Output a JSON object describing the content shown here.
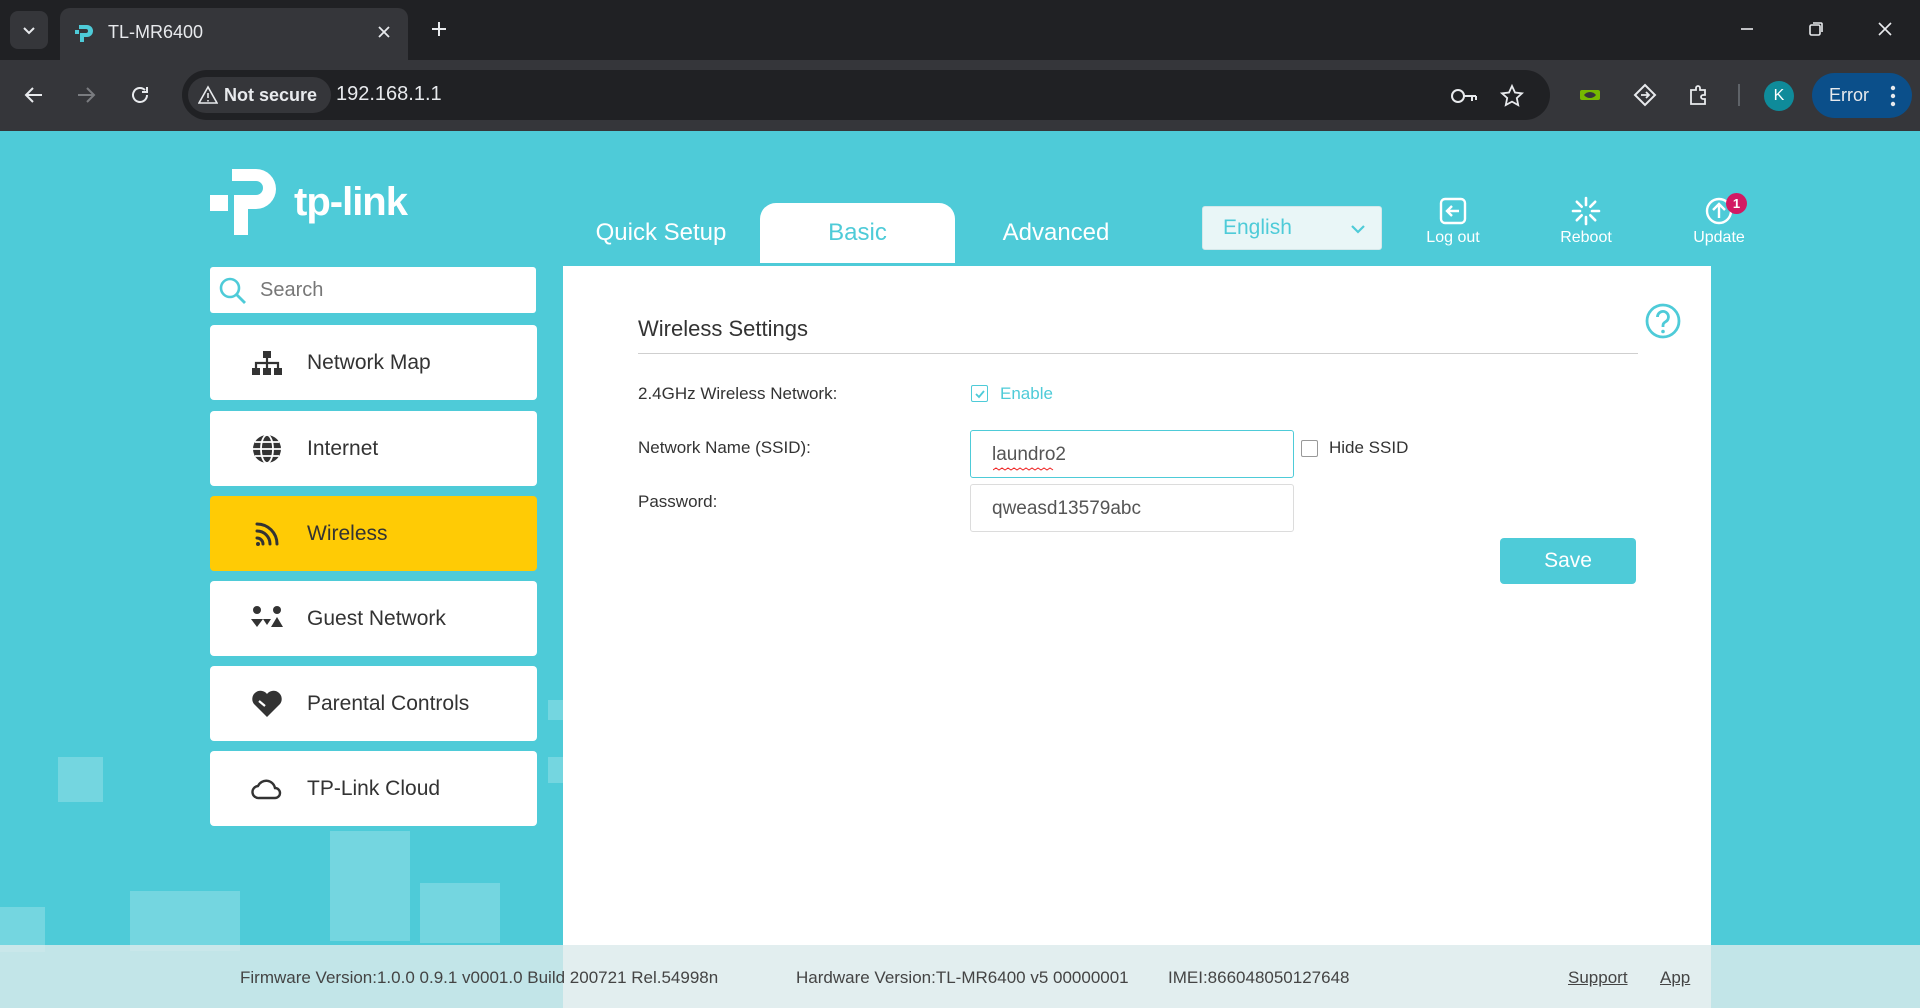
{
  "browser": {
    "tab_title": "TL-MR6400",
    "security_label": "Not secure",
    "url": "192.168.1.1",
    "avatar_letter": "K",
    "error_label": "Error"
  },
  "router": {
    "logo_text": "tp-link",
    "top_tabs": [
      "Quick Setup",
      "Basic",
      "Advanced"
    ],
    "active_tab": "Basic",
    "language": "English",
    "tools": {
      "logout": "Log out",
      "reboot": "Reboot",
      "update": "Update",
      "update_badge": "1"
    },
    "search_placeholder": "Search",
    "sidebar": [
      {
        "label": "Network Map",
        "icon": "network-map-icon"
      },
      {
        "label": "Internet",
        "icon": "globe-icon"
      },
      {
        "label": "Wireless",
        "icon": "wifi-icon",
        "active": true
      },
      {
        "label": "Guest Network",
        "icon": "guest-network-icon"
      },
      {
        "label": "Parental Controls",
        "icon": "heart-icon"
      },
      {
        "label": "TP-Link Cloud",
        "icon": "cloud-icon"
      }
    ],
    "panel": {
      "title": "Wireless Settings",
      "wireless_label": "2.4GHz Wireless Network:",
      "enable_label": "Enable",
      "enable_checked": true,
      "ssid_label": "Network Name (SSID):",
      "ssid_value": "laundro2",
      "hide_ssid_label": "Hide SSID",
      "hide_ssid_checked": false,
      "password_label": "Password:",
      "password_value": "qweasd13579abc",
      "save_label": "Save"
    },
    "footer": {
      "firmware": "Firmware Version:1.0.0 0.9.1 v0001.0 Build 200721 Rel.54998n",
      "hardware": "Hardware Version:TL-MR6400 v5 00000001",
      "imei": "IMEI:866048050127648",
      "support": "Support",
      "app": "App"
    }
  },
  "colors": {
    "brand": "#4ecbd8",
    "active_nav": "#ffcb05",
    "badge": "#d21a63"
  }
}
